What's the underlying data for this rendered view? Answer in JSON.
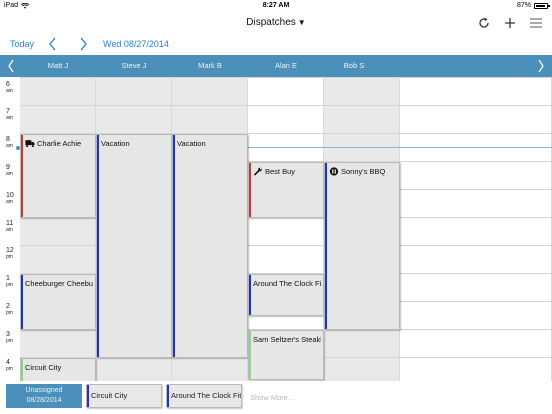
{
  "status_bar": {
    "device": "iPad",
    "time": "8:27 AM",
    "battery": "87%"
  },
  "nav": {
    "title": "Dispatches",
    "caret": "▼",
    "icons": [
      "refresh-icon",
      "plus-icon",
      "menu-icon"
    ]
  },
  "date_bar": {
    "today": "Today",
    "date": "Wed 08/27/2014"
  },
  "resources": [
    "Matt J",
    "Steve J",
    "Mark B",
    "Alan E",
    "Bob S"
  ],
  "hours": [
    {
      "h": "6",
      "ampm": "am"
    },
    {
      "h": "7",
      "ampm": "am"
    },
    {
      "h": "8",
      "ampm": "am"
    },
    {
      "h": "9",
      "ampm": "am"
    },
    {
      "h": "10",
      "ampm": "am"
    },
    {
      "h": "11",
      "ampm": "am"
    },
    {
      "h": "12",
      "ampm": "pm"
    },
    {
      "h": "1",
      "ampm": "pm"
    },
    {
      "h": "2",
      "ampm": "pm"
    },
    {
      "h": "3",
      "ampm": "pm"
    },
    {
      "h": "4",
      "ampm": "pm"
    }
  ],
  "colors": {
    "header": "#4b90ba",
    "link": "#2a7fd6",
    "red": "#d13438",
    "blue": "#1f2fd6",
    "green": "#8fd18f"
  },
  "events": [
    {
      "title": "Charlie Achie",
      "icon": "truck-icon",
      "status": "red"
    },
    {
      "title": "Cheeburger Cheeburger",
      "status": "blue"
    },
    {
      "title": "Circuit City",
      "status": "green"
    },
    {
      "title": "Vacation",
      "status": "blue"
    },
    {
      "title": "Vacation",
      "status": "blue"
    },
    {
      "title": "Best Buy",
      "icon": "wrench-icon",
      "status": "red"
    },
    {
      "title": "Around The Clock Fitness",
      "status": "blue"
    },
    {
      "title": "Sam Seltzer's Steakhouse",
      "status": "green"
    },
    {
      "title": "Sonny's BBQ",
      "icon": "pause-icon",
      "status": "blue"
    }
  ],
  "bottom": {
    "unassigned_label": "Unassigned",
    "unassigned_date": "08/28/2014",
    "chips": [
      {
        "title": "Circuit City",
        "status": "blue"
      },
      {
        "title": "Around The Clock Fitness",
        "status": "blue"
      }
    ],
    "show_more": "Show More..."
  }
}
